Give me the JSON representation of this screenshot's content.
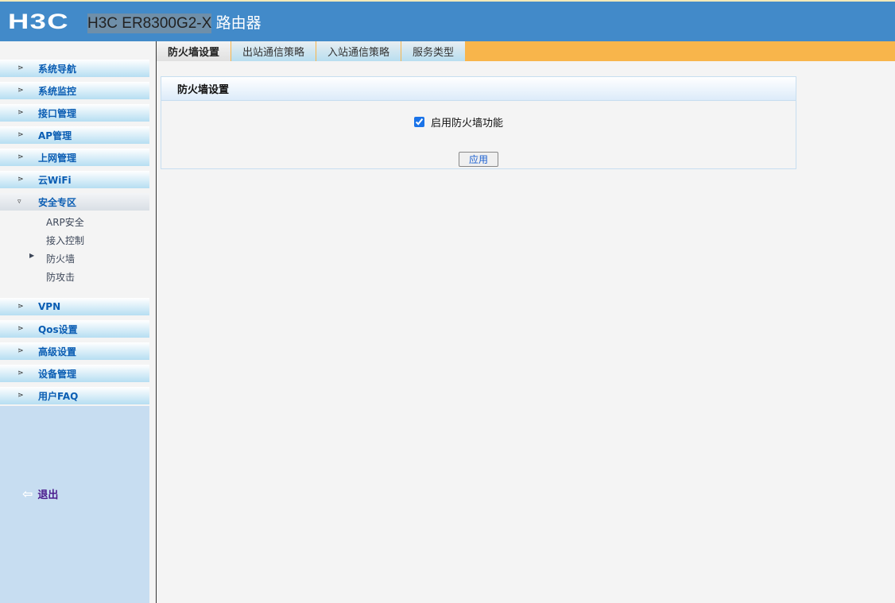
{
  "header": {
    "logo": "H3C",
    "model": "H3C ER8300G2-X",
    "suffix": " 路由器"
  },
  "sidebar": {
    "menus": [
      {
        "label": "系统导航"
      },
      {
        "label": "系统监控"
      },
      {
        "label": "接口管理"
      },
      {
        "label": "AP管理"
      },
      {
        "label": "上网管理"
      },
      {
        "label": "云WiFi"
      },
      {
        "label": "安全专区"
      },
      {
        "label": "VPN"
      },
      {
        "label": "Qos设置"
      },
      {
        "label": "高级设置"
      },
      {
        "label": "设备管理"
      },
      {
        "label": "用户FAQ"
      }
    ],
    "submenu": [
      {
        "label": "ARP安全"
      },
      {
        "label": "接入控制"
      },
      {
        "label": "防火墙"
      },
      {
        "label": "防攻击"
      }
    ],
    "logout": "退出"
  },
  "tabs": [
    {
      "label": "防火墙设置"
    },
    {
      "label": "出站通信策略"
    },
    {
      "label": "入站通信策略"
    },
    {
      "label": "服务类型"
    }
  ],
  "panel": {
    "title": "防火墙设置",
    "checkbox_label": "启用防火墙功能",
    "checkbox_checked": true,
    "apply": "应用"
  },
  "colors": {
    "header": "#428ac9",
    "tabbar": "#f8b54b",
    "menu_text": "#0a5db3"
  }
}
